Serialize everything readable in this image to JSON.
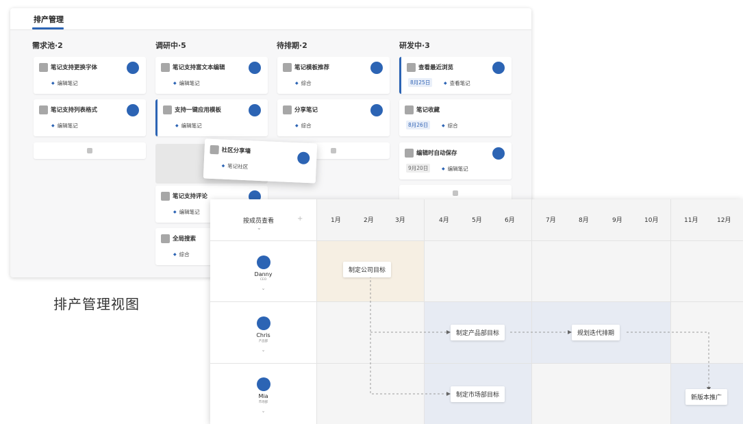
{
  "kanban": {
    "tab": "排产管理",
    "columns": [
      {
        "title": "需求池·2",
        "cards": [
          {
            "title": "笔记支持更换字体",
            "tag": "编辑笔记"
          },
          {
            "title": "笔记支持列表格式",
            "tag": "编辑笔记"
          }
        ]
      },
      {
        "title": "调研中·5",
        "cards": [
          {
            "title": "笔记支持富文本编辑",
            "tag": "编辑笔记"
          },
          {
            "title": "支持一键应用模板",
            "tag": "编辑笔记"
          },
          {
            "title": "笔记支持评论",
            "tag": "编辑笔记"
          },
          {
            "title": "全局搜索",
            "tag": "综合"
          }
        ]
      },
      {
        "title": "待排期·2",
        "cards": [
          {
            "title": "笔记模板推荐",
            "tag": "综合"
          },
          {
            "title": "分享笔记",
            "tag": "综合"
          }
        ]
      },
      {
        "title": "研发中·3",
        "cards": [
          {
            "title": "查看最近浏览",
            "date": "8月25日",
            "tag": "查看笔记"
          },
          {
            "title": "笔记收藏",
            "date": "8月26日",
            "tag": "综合"
          },
          {
            "title": "编辑时自动保存",
            "date": "9月20日",
            "tag": "编辑笔记"
          }
        ]
      }
    ],
    "dragging_card": {
      "title": "社区分享墙",
      "tag": "笔记社区"
    },
    "caption": "排产管理视图"
  },
  "timeline": {
    "group_by": "按成员查看",
    "add_symbol": "+",
    "months": [
      "1月",
      "2月",
      "3月",
      "4月",
      "5月",
      "6月",
      "7月",
      "8月",
      "9月",
      "10月",
      "11月",
      "12月"
    ],
    "members": [
      {
        "name": "Danny",
        "role": "CEO"
      },
      {
        "name": "Chris",
        "role": "产品部"
      },
      {
        "name": "Mia",
        "role": "市场部"
      }
    ],
    "tasks": [
      {
        "label": "制定公司目标"
      },
      {
        "label": "制定产品部目标"
      },
      {
        "label": "规划迭代排期"
      },
      {
        "label": "制定市场部目标"
      },
      {
        "label": "新版本推广"
      }
    ],
    "colors": {
      "warm": "#f6efe3",
      "cool": "#e7ebf3",
      "neutral": "#f5f5f5",
      "accent": "#2c64b4"
    }
  }
}
